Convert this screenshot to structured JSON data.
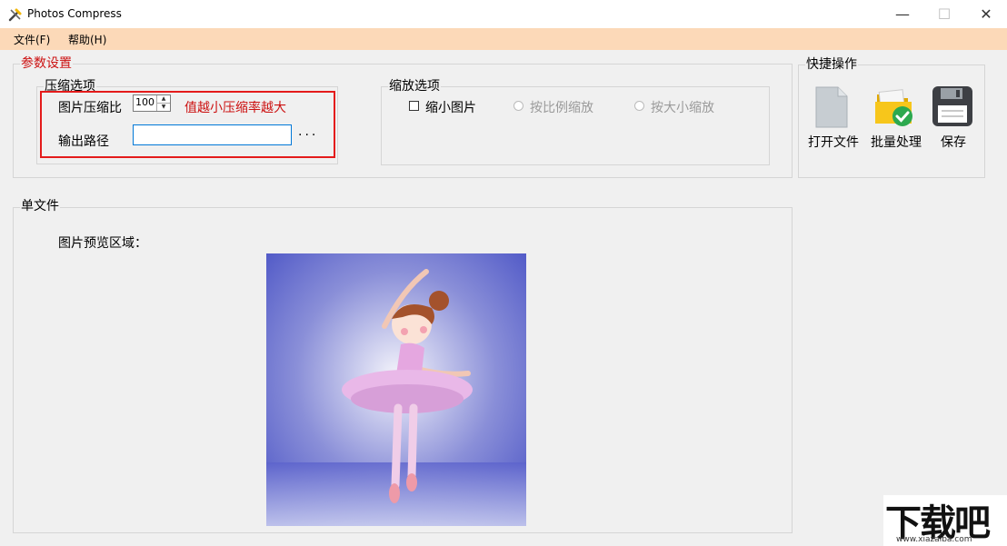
{
  "window": {
    "title": "Photos Compress",
    "minimize_glyph": "—",
    "maximize_glyph": "☐",
    "close_glyph": "✕"
  },
  "menu": [
    {
      "label": "文件(F)"
    },
    {
      "label": "帮助(H)"
    }
  ],
  "params": {
    "group_label": "参数设置",
    "compress_group_label": "压缩选项",
    "ratio_label": "图片压缩比",
    "ratio_value": "100",
    "ratio_hint": "值越小压缩率越大",
    "output_label": "输出路径",
    "output_value": "",
    "browse_label": "···",
    "scale_group_label": "缩放选项",
    "shrink_label": "缩小图片",
    "scale_ratio_label": "按比例缩放",
    "scale_size_label": "按大小缩放"
  },
  "quick": {
    "group_label": "快捷操作",
    "open_label": "打开文件",
    "batch_label": "批量处理",
    "save_label": "保存",
    "icons": [
      "file-icon",
      "folder-check-icon",
      "floppy-disk-icon"
    ]
  },
  "single": {
    "group_label": "单文件",
    "preview_label": "图片预览区域："
  },
  "watermark": {
    "logo_text": "下载吧",
    "url_text": "www.xiazaiba.com"
  }
}
